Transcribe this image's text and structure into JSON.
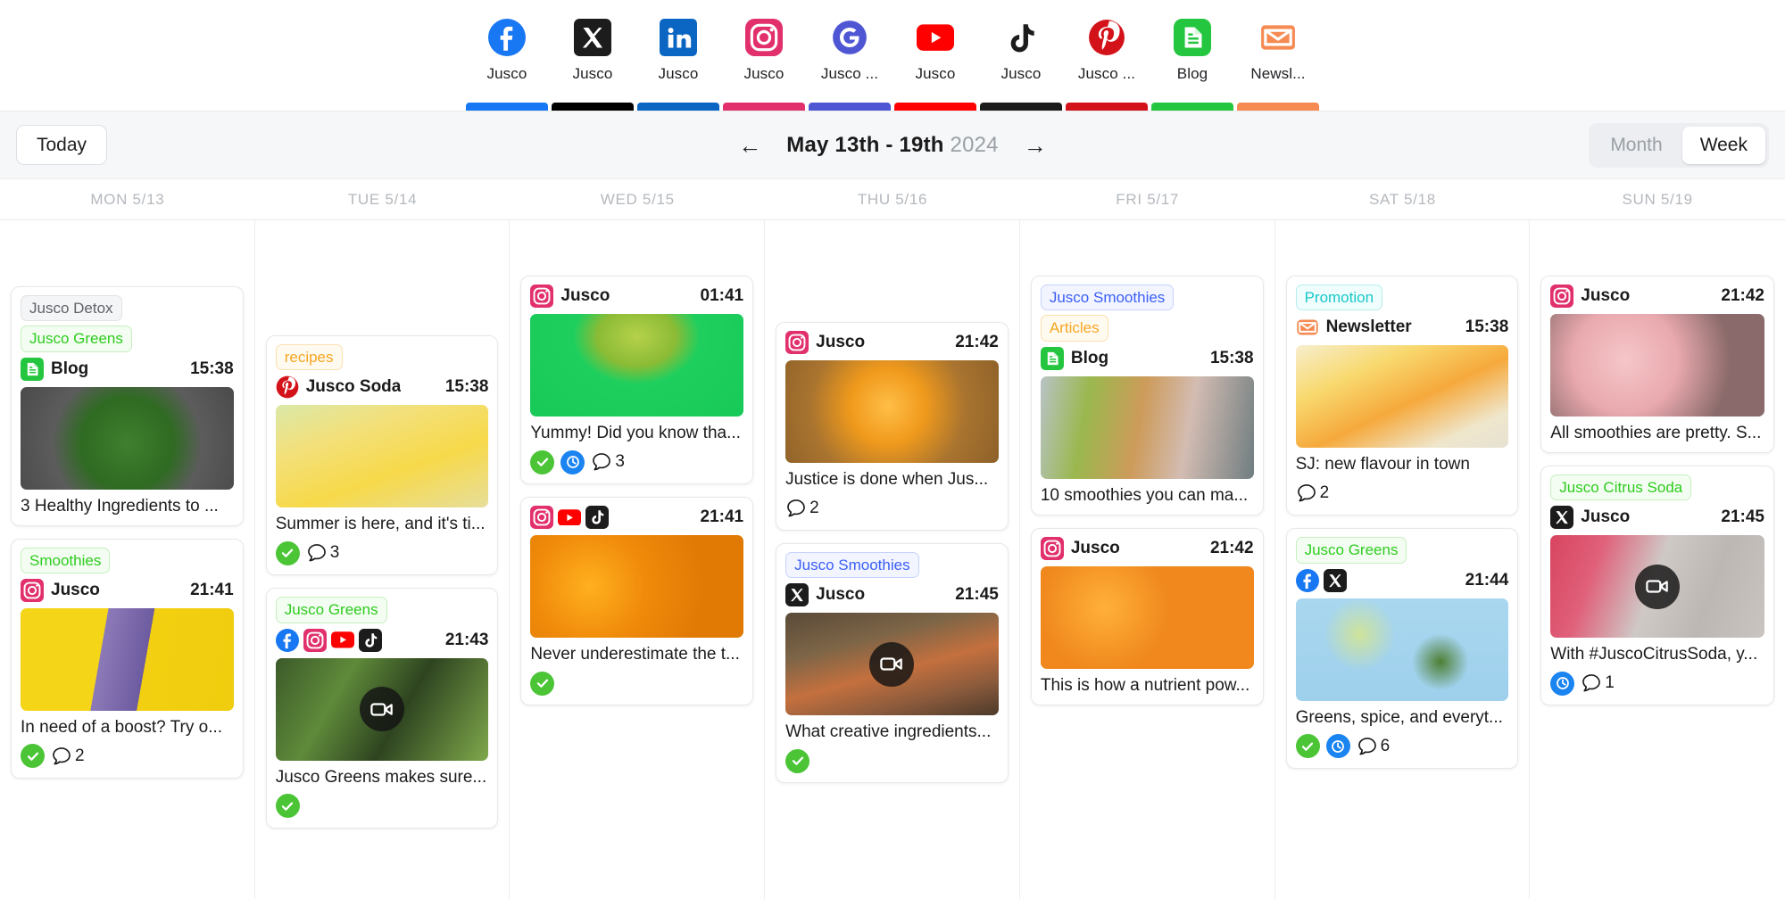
{
  "channels": [
    {
      "name": "Jusco",
      "icon": "facebook-icon",
      "color": "#1877f2"
    },
    {
      "name": "Jusco",
      "icon": "x-twitter-icon",
      "color": "#000000"
    },
    {
      "name": "Jusco",
      "icon": "linkedin-icon",
      "color": "#0a66c2"
    },
    {
      "name": "Jusco",
      "icon": "instagram-icon",
      "color": "#e1306c"
    },
    {
      "name": "Jusco ...",
      "icon": "google-business-icon",
      "color": "#4f56d3"
    },
    {
      "name": "Jusco",
      "icon": "youtube-icon",
      "color": "#ff0000"
    },
    {
      "name": "Jusco",
      "icon": "tiktok-icon",
      "color": "#1c1c1c"
    },
    {
      "name": "Jusco ...",
      "icon": "pinterest-icon",
      "color": "#d3121a"
    },
    {
      "name": "Blog",
      "icon": "blog-document-icon",
      "color": "#25c63f"
    },
    {
      "name": "Newsl...",
      "icon": "newsletter-envelope-icon",
      "color": "#f58b52"
    }
  ],
  "toolbar": {
    "today_label": "Today",
    "prev_label": "←",
    "next_label": "→",
    "date_range": "May 13th - 19th",
    "year": "2024",
    "month_label": "Month",
    "week_label": "Week",
    "active_view": "Week"
  },
  "days": [
    {
      "header": "MON 5/13",
      "top_gap": 60,
      "posts": [
        {
          "tags": [
            {
              "text": "Jusco Detox",
              "style": "gray"
            },
            {
              "text": "Jusco Greens",
              "style": "green"
            }
          ],
          "platforms": [
            "blog-document-icon"
          ],
          "channel": "Blog",
          "time": "15:38",
          "thumb": "spinach-bowl",
          "caption": "3 Healthy Ingredients to ...",
          "statuses": []
        },
        {
          "tags": [
            {
              "text": "Smoothies",
              "style": "green"
            }
          ],
          "platforms": [
            "instagram-icon"
          ],
          "channel": "Jusco",
          "time": "21:41",
          "thumb": "juice-bottle-yellow",
          "caption": "In need of a boost? Try o...",
          "statuses": [
            {
              "type": "check"
            },
            {
              "type": "comment",
              "count": "2"
            }
          ]
        }
      ]
    },
    {
      "header": "TUE 5/14",
      "top_gap": 115,
      "posts": [
        {
          "tags": [
            {
              "text": "recipes",
              "style": "orange"
            }
          ],
          "platforms": [
            "pinterest-icon"
          ],
          "channel": "Jusco Soda",
          "time": "15:38",
          "thumb": "lemonade-glass",
          "caption": "Summer is here, and it's ti...",
          "statuses": [
            {
              "type": "check"
            },
            {
              "type": "comment",
              "count": "3"
            }
          ]
        },
        {
          "tags": [
            {
              "text": "Jusco Greens",
              "style": "green"
            }
          ],
          "platforms": [
            "facebook-icon",
            "instagram-icon",
            "youtube-icon",
            "tiktok-icon"
          ],
          "channel": "",
          "time": "21:43",
          "thumb": "avocado-greens",
          "video": true,
          "caption": "Jusco Greens makes sure...",
          "statuses": [
            {
              "type": "check"
            }
          ]
        }
      ]
    },
    {
      "header": "WED 5/15",
      "top_gap": 48,
      "posts": [
        {
          "tags": [],
          "platforms": [
            "instagram-icon"
          ],
          "channel": "Jusco",
          "time": "01:41",
          "thumb": "kiwi-green",
          "caption": "Yummy! Did you know tha...",
          "statuses": [
            {
              "type": "check"
            },
            {
              "type": "clock"
            },
            {
              "type": "comment",
              "count": "3"
            }
          ]
        },
        {
          "tags": [],
          "platforms": [
            "instagram-icon",
            "youtube-icon",
            "tiktok-icon"
          ],
          "channel": "",
          "time": "21:41",
          "thumb": "orange-slices",
          "caption": "Never underestimate the t...",
          "statuses": [
            {
              "type": "check"
            }
          ]
        }
      ]
    },
    {
      "header": "THU 5/16",
      "top_gap": 100,
      "posts": [
        {
          "tags": [],
          "platforms": [
            "instagram-icon"
          ],
          "channel": "Jusco",
          "time": "21:42",
          "thumb": "orange-board",
          "caption": "Justice is done when Jus...",
          "statuses": [
            {
              "type": "comment",
              "count": "2"
            }
          ]
        },
        {
          "tags": [
            {
              "text": "Jusco Smoothies",
              "style": "blue"
            }
          ],
          "platforms": [
            "x-twitter-icon"
          ],
          "channel": "Jusco",
          "time": "21:45",
          "thumb": "smoothie-shots",
          "video": true,
          "caption": "What creative ingredients...",
          "statuses": [
            {
              "type": "check"
            }
          ]
        }
      ]
    },
    {
      "header": "FRI 5/17",
      "top_gap": 48,
      "posts": [
        {
          "tags": [
            {
              "text": "Jusco Smoothies",
              "style": "blue"
            },
            {
              "text": "Articles",
              "style": "orange"
            }
          ],
          "platforms": [
            "blog-document-icon"
          ],
          "channel": "Blog",
          "time": "15:38",
          "thumb": "three-smoothies",
          "caption": "10 smoothies you can ma...",
          "statuses": []
        },
        {
          "tags": [],
          "platforms": [
            "instagram-icon"
          ],
          "channel": "Jusco",
          "time": "21:42",
          "thumb": "apricots",
          "caption": "This is how a nutrient pow...",
          "statuses": []
        }
      ]
    },
    {
      "header": "SAT 5/18",
      "top_gap": 48,
      "posts": [
        {
          "tags": [
            {
              "text": "Promotion",
              "style": "teal"
            }
          ],
          "platforms": [
            "newsletter-envelope-icon"
          ],
          "channel": "Newsletter",
          "time": "15:38",
          "thumb": "orange-jar",
          "caption": "SJ: new flavour in town",
          "statuses": [
            {
              "type": "comment",
              "count": "2"
            }
          ]
        },
        {
          "tags": [
            {
              "text": "Jusco Greens",
              "style": "green"
            }
          ],
          "platforms": [
            "facebook-icon",
            "x-twitter-icon"
          ],
          "channel": "",
          "time": "21:44",
          "thumb": "lime-mint-blue",
          "caption": "Greens, spice, and everyt...",
          "statuses": [
            {
              "type": "check"
            },
            {
              "type": "clock"
            },
            {
              "type": "comment",
              "count": "6"
            }
          ]
        }
      ]
    },
    {
      "header": "SUN 5/19",
      "top_gap": 48,
      "posts": [
        {
          "tags": [],
          "platforms": [
            "instagram-icon"
          ],
          "channel": "Jusco",
          "time": "21:42",
          "thumb": "berry-smoothie",
          "caption": "All smoothies are pretty. S...",
          "statuses": []
        },
        {
          "tags": [
            {
              "text": "Jusco Citrus Soda",
              "style": "green"
            }
          ],
          "platforms": [
            "x-twitter-icon"
          ],
          "channel": "Jusco",
          "time": "21:45",
          "thumb": "pink-drink-marble",
          "video": true,
          "caption": "With #JuscoCitrusSoda, y...",
          "statuses": [
            {
              "type": "clock"
            },
            {
              "type": "comment",
              "count": "1"
            }
          ]
        }
      ]
    }
  ]
}
